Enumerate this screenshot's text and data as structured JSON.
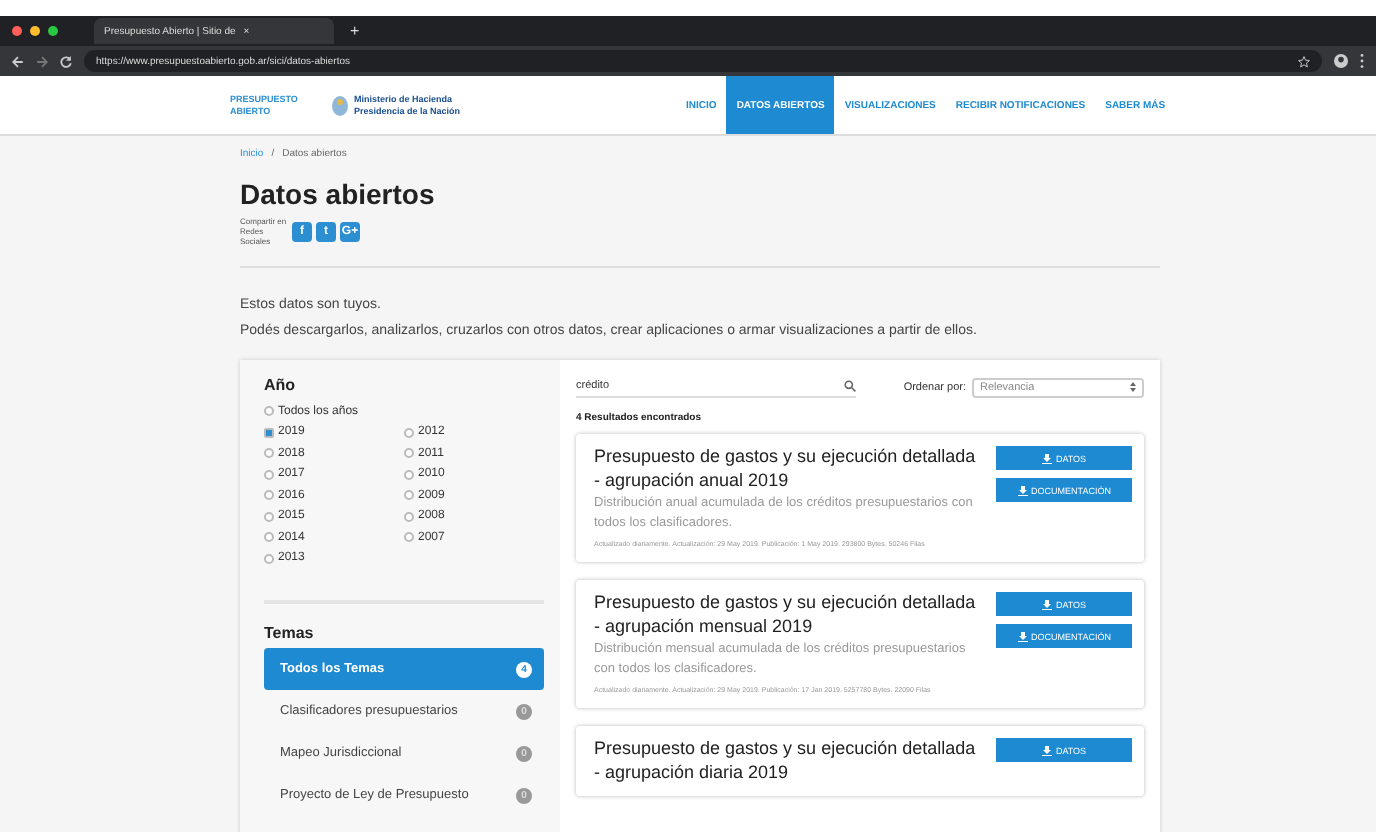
{
  "browser": {
    "tab_title": "Presupuesto Abierto | Sitio de",
    "tab_close": "×",
    "new_tab": "+",
    "url": "https://www.presupuestoabierto.gob.ar/sici/datos-abiertos"
  },
  "header": {
    "logo_text": "PRESUPUESTO ABIERTO",
    "ministry": "Ministerio de Hacienda",
    "presidency": "Presidencia de la Nación",
    "nav": [
      {
        "label": "INICIO",
        "selected": false
      },
      {
        "label": "DATOS ABIERTOS",
        "selected": true
      },
      {
        "label": "VISUALIZACIONES",
        "selected": false
      },
      {
        "label": "RECIBIR NOTIFICACIONES",
        "selected": false
      },
      {
        "label": "SABER MÁS",
        "selected": false
      }
    ]
  },
  "breadcrumb": [
    {
      "label": "Inicio",
      "kind": "link"
    },
    {
      "label": "/",
      "kind": "separator"
    },
    {
      "label": "Datos abiertos",
      "kind": "current"
    }
  ],
  "title": "Datos abiertos",
  "share": {
    "label": "Compartir en Redes Sociales",
    "buttons": [
      "f",
      "t",
      "G+"
    ]
  },
  "intro": [
    "Estos datos son tuyos.",
    "Podés descargarlos, analizarlos, cruzarlos con otros datos, crear aplicaciones o armar visualizaciones a partir de ellos."
  ],
  "filters": {
    "year_title": "Año",
    "all_years": {
      "label": "Todos los años",
      "checked": false
    },
    "years": [
      {
        "label": "2019",
        "checked": true
      },
      {
        "label": "2018",
        "checked": false
      },
      {
        "label": "2017",
        "checked": false
      },
      {
        "label": "2016",
        "checked": false
      },
      {
        "label": "2015",
        "checked": false
      },
      {
        "label": "2014",
        "checked": false
      },
      {
        "label": "2013",
        "checked": false
      },
      {
        "label": "2012",
        "checked": false
      },
      {
        "label": "2011",
        "checked": false
      },
      {
        "label": "2010",
        "checked": false
      },
      {
        "label": "2009",
        "checked": false
      },
      {
        "label": "2008",
        "checked": false
      },
      {
        "label": "2007",
        "checked": false
      }
    ],
    "topics_title": "Temas",
    "topics": [
      {
        "label": "Todos los Temas",
        "count": "4",
        "selected": true
      },
      {
        "label": "Clasificadores presupuestarios",
        "count": "0",
        "selected": false
      },
      {
        "label": "Mapeo Jurisdiccional",
        "count": "0",
        "selected": false
      },
      {
        "label": "Proyecto de Ley de Presupuesto",
        "count": "0",
        "selected": false
      }
    ]
  },
  "search": {
    "value": "crédito",
    "sort_label": "Ordenar por:",
    "sort_value": "Relevancia",
    "results_count": "4 Resultados encontrados"
  },
  "results": [
    {
      "title": "Presupuesto de gastos y su ejecución detallada - agrupación anual 2019",
      "description": "Distribución anual acumulada de los créditos presupuestarios con todos los clasificadores.",
      "meta": "Actualizado diariamente. Actualización: 29 May 2019. Publicación: 1 May 2019. 293800 Bytes. 50246 Filas",
      "buttons": [
        "DATOS",
        "DOCUMENTACIÓN"
      ]
    },
    {
      "title": "Presupuesto de gastos y su ejecución detallada - agrupación mensual 2019",
      "description": "Distribución mensual acumulada de los créditos presupuestarios con todos los clasificadores.",
      "meta": "Actualizado diariamente. Actualización: 29 May 2019. Publicación: 17 Jan 2019. 5257780 Bytes. 22090 Filas",
      "buttons": [
        "DATOS",
        "DOCUMENTACIÓN"
      ]
    },
    {
      "title": "Presupuesto de gastos y su ejecución detallada - agrupación diaria 2019",
      "buttons": [
        "DATOS"
      ]
    }
  ]
}
